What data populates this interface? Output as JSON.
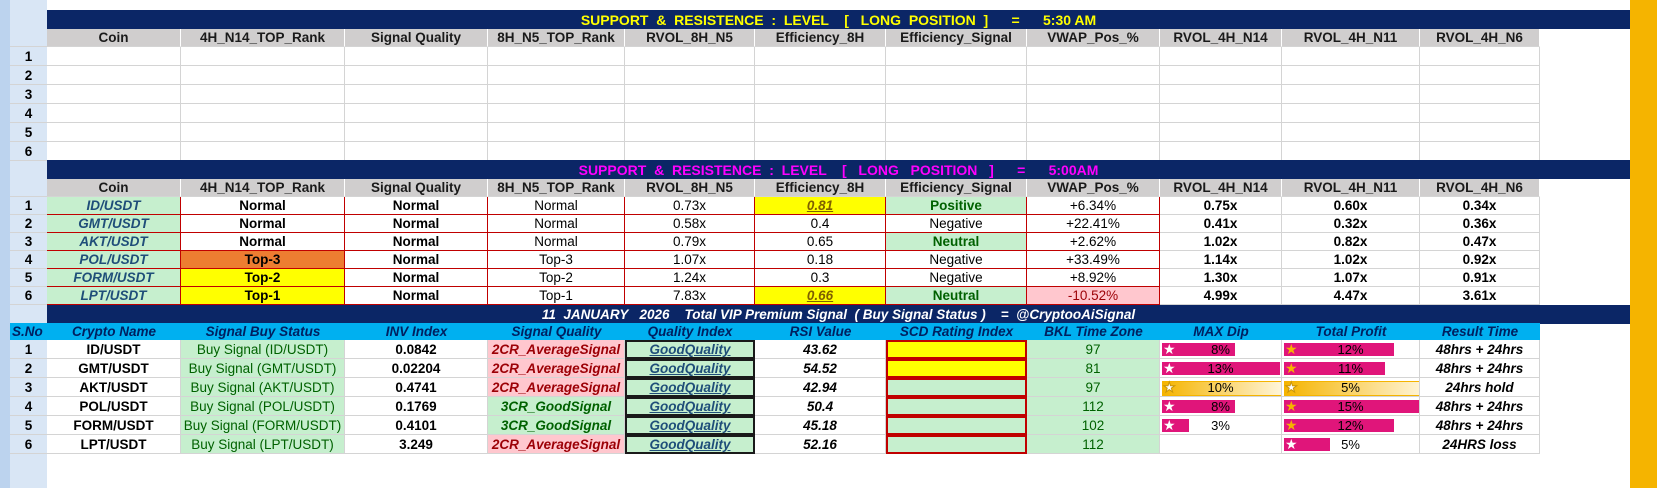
{
  "banner1": "SUPPORT  &  RESISTENCE  :  LEVEL    [   LONG  POSITION  ]      =      5:30 AM",
  "banner2": "SUPPORT  &  RESISTENCE  :  LEVEL    [   LONG   POSITION   ]      =      5:00AM",
  "banner3": "11  JANUARY   2026    Total VIP Premium Signal  ( Buy Signal Status )    =  @CryptooAiSignal",
  "headers1": [
    "Coin",
    "4H_N14_TOP_Rank",
    "Signal Quality",
    "8H_N5_TOP_Rank",
    "RVOL_8H_N5",
    "Efficiency_8H",
    "Efficiency_Signal",
    "VWAP_Pos_%",
    "RVOL_4H_N14",
    "RVOL_4H_N11",
    "RVOL_4H_N6"
  ],
  "empty_rows": [
    "1",
    "2",
    "3",
    "4",
    "5",
    "6"
  ],
  "rows2": [
    {
      "n": "1",
      "coin": "ID/USDT",
      "r4": "Normal",
      "sq": "Normal",
      "r8": "Normal",
      "rv8": "0.73x",
      "eff": "0.81",
      "effsig": "Positive",
      "vwap": "+6.34%",
      "a": "0.75x",
      "b": "0.60x",
      "c": "0.34x"
    },
    {
      "n": "2",
      "coin": "GMT/USDT",
      "r4": "Normal",
      "sq": "Normal",
      "r8": "Normal",
      "rv8": "0.58x",
      "eff": "0.4",
      "effsig": "Negative",
      "vwap": "+22.41%",
      "a": "0.41x",
      "b": "0.32x",
      "c": "0.36x"
    },
    {
      "n": "3",
      "coin": "AKT/USDT",
      "r4": "Normal",
      "sq": "Normal",
      "r8": "Normal",
      "rv8": "0.79x",
      "eff": "0.65",
      "effsig": "Neutral",
      "vwap": "+2.62%",
      "a": "1.02x",
      "b": "0.82x",
      "c": "0.47x"
    },
    {
      "n": "4",
      "coin": "POL/USDT",
      "r4": "Top-3",
      "sq": "Normal",
      "r8": "Top-3",
      "rv8": "1.07x",
      "eff": "0.18",
      "effsig": "Negative",
      "vwap": "+33.49%",
      "a": "1.14x",
      "b": "1.02x",
      "c": "0.92x"
    },
    {
      "n": "5",
      "coin": "FORM/USDT",
      "r4": "Top-2",
      "sq": "Normal",
      "r8": "Top-2",
      "rv8": "1.24x",
      "eff": "0.3",
      "effsig": "Negative",
      "vwap": "+8.92%",
      "a": "1.30x",
      "b": "1.07x",
      "c": "0.91x"
    },
    {
      "n": "6",
      "coin": "LPT/USDT",
      "r4": "Top-1",
      "sq": "Normal",
      "r8": "Top-1",
      "rv8": "7.83x",
      "eff": "0.66",
      "effsig": "Neutral",
      "vwap": "-10.52%",
      "a": "4.99x",
      "b": "4.47x",
      "c": "3.61x"
    }
  ],
  "headers3": [
    "S.No",
    "Crypto Name",
    "Signal Buy Status",
    "INV  Index",
    "Signal Quality",
    "Quality Index",
    "RSI Value",
    "SCD  Rating Index",
    "BKL Time Zone",
    "MAX Dip",
    "Total Profit",
    "Result Time"
  ],
  "rows3": [
    {
      "n": "1",
      "name": "ID/USDT",
      "status": "Buy Signal (ID/USDT)",
      "inv": "0.0842",
      "sq": "2CR_AverageSignal",
      "qi": "GoodQuality",
      "rsi": "43.62",
      "bkl": "97",
      "dip": "8%",
      "dipv": 0.08,
      "profit": "12%",
      "profv": 0.12,
      "result": "48hrs + 24hrs"
    },
    {
      "n": "2",
      "name": "GMT/USDT",
      "status": "Buy Signal (GMT/USDT)",
      "inv": "0.02204",
      "sq": "2CR_AverageSignal",
      "qi": "GoodQuality",
      "rsi": "54.52",
      "bkl": "81",
      "dip": "13%",
      "dipv": 0.13,
      "profit": "11%",
      "profv": 0.11,
      "result": "48hrs + 24hrs"
    },
    {
      "n": "3",
      "name": "AKT/USDT",
      "status": "Buy Signal (AKT/USDT)",
      "inv": "0.4741",
      "sq": "2CR_AverageSignal",
      "qi": "GoodQuality",
      "rsi": "42.94",
      "bkl": "97",
      "dip": "10%",
      "dipv": 0.1,
      "profit": "5%",
      "profv": 0.05,
      "result": "24hrs hold"
    },
    {
      "n": "4",
      "name": "POL/USDT",
      "status": "Buy Signal (POL/USDT)",
      "inv": "0.1769",
      "sq": "3CR_GoodSignal",
      "qi": "GoodQuality",
      "rsi": "50.4",
      "bkl": "112",
      "dip": "8%",
      "dipv": 0.08,
      "profit": "15%",
      "profv": 0.15,
      "result": "48hrs + 24hrs"
    },
    {
      "n": "5",
      "name": "FORM/USDT",
      "status": "Buy Signal (FORM/USDT)",
      "inv": "0.4101",
      "sq": "3CR_GoodSignal",
      "qi": "GoodQuality",
      "rsi": "45.18",
      "bkl": "102",
      "dip": "3%",
      "dipv": 0.03,
      "profit": "12%",
      "profv": 0.12,
      "result": "48hrs + 24hrs"
    },
    {
      "n": "6",
      "name": "LPT/USDT",
      "status": "Buy Signal (LPT/USDT)",
      "inv": "3.249",
      "sq": "2CR_AverageSignal",
      "qi": "GoodQuality",
      "rsi": "52.16",
      "bkl": "112",
      "dip": "",
      "dipv": 0,
      "profit": "5%",
      "profv": 0.05,
      "result": "24HRS loss"
    }
  ],
  "colors": {
    "banner": "#0b2666",
    "yellow_text": "#ffff00",
    "magenta_text": "#ff00ff",
    "cyan_header": "#00b0f0",
    "bar_magenta": "#e0157a",
    "bar_gold": "#f5b400"
  }
}
